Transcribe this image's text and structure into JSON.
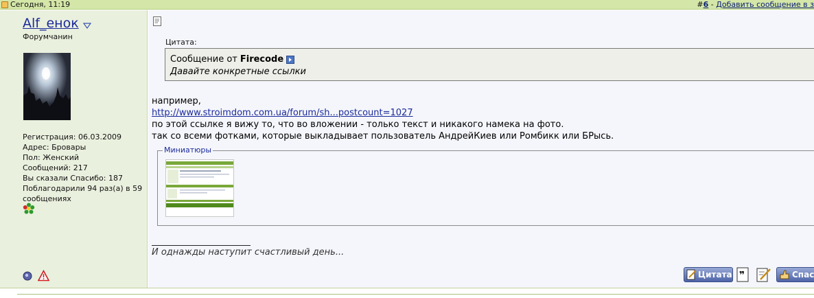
{
  "post_header": {
    "date": "Сегодня, 11:19",
    "hash": "#",
    "post_number": "6",
    "separator": " - ",
    "add_link": "Добавить сообщение в з"
  },
  "user": {
    "name": "Alf_енок",
    "title": "Форумчанин",
    "registration": "Регистрация: 06.03.2009",
    "address": "Адрес: Бровары",
    "gender": "Пол: Женский",
    "posts": "Сообщений: 217",
    "said_thanks": "Вы сказали Спасибо: 187",
    "thanked": "Поблагодарили 94 раз(а) в 59 сообщениях"
  },
  "post": {
    "quote_label": "Цитата:",
    "quote_from": "Сообщение от",
    "quote_author": "Firecode",
    "quote_text": "Давайте конкретные ссылки",
    "line1": "например,",
    "link": "http://www.stroimdom.com.ua/forum/sh...postcount=1027",
    "line2": "по этой ссылке я вижу то, что во вложении - только текст и никакого намека на фото.",
    "line3": "так со всеми фотками, которые выкладывает пользователь АндрейКиев или Ромбикк или БРысь.",
    "attachments_legend": "Миниатюры",
    "signature": "И однажды наступит счастливый день..."
  },
  "buttons": {
    "quote": "Цитата",
    "thanks": "Спасибо"
  },
  "colors": {
    "header_bg": "#d4e6a8",
    "user_panel_bg": "#eaf0de",
    "content_bg": "#f5f6fb",
    "link": "#1a2a9a"
  }
}
